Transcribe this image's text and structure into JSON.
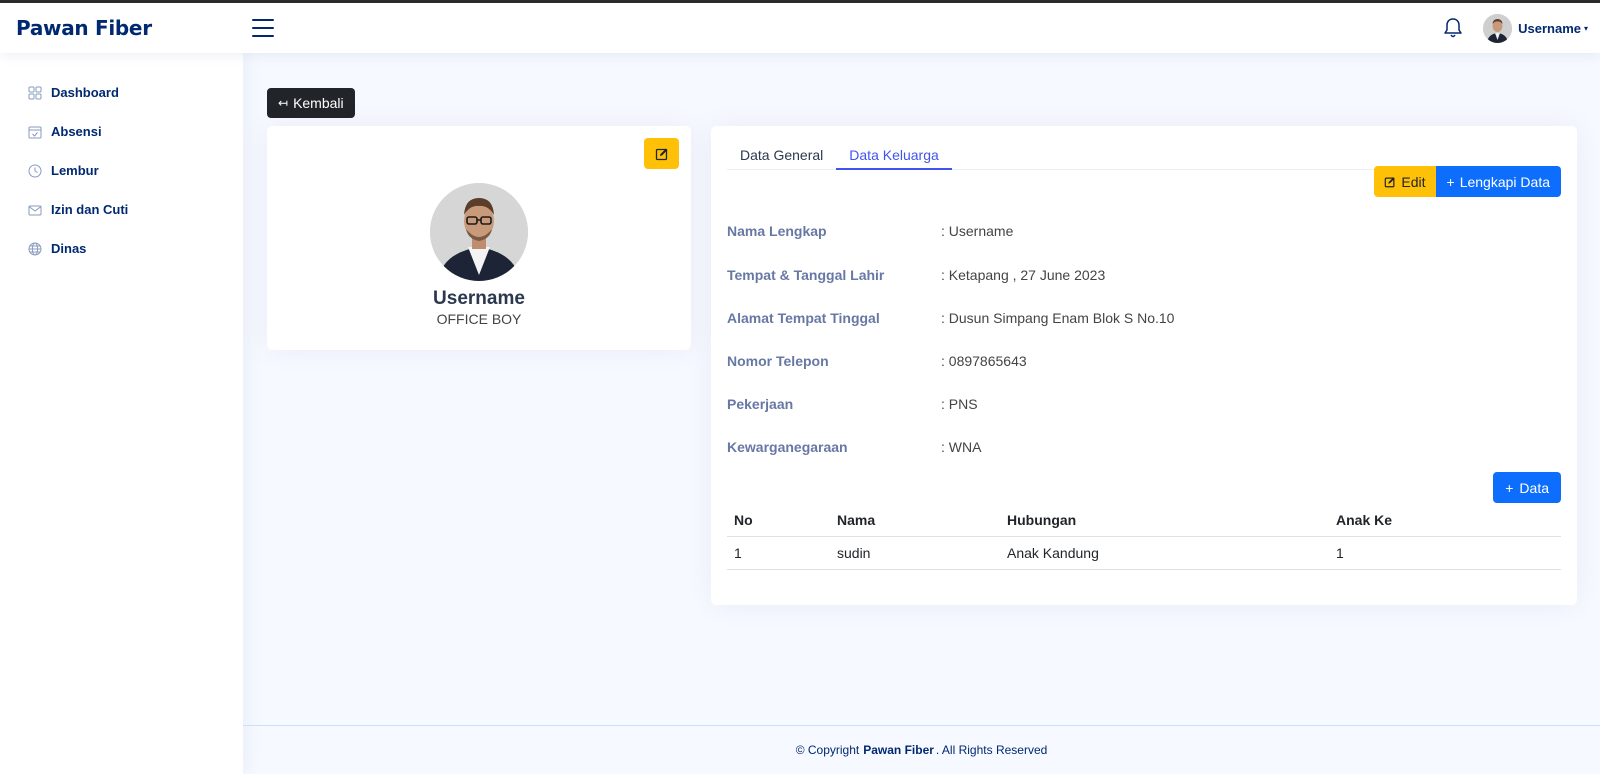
{
  "header": {
    "brand": "Pawan Fiber",
    "user_name": "Username",
    "caret": "▾"
  },
  "sidebar": {
    "items": [
      {
        "label": "Dashboard",
        "icon": "grid-icon"
      },
      {
        "label": "Absensi",
        "icon": "calendar-icon"
      },
      {
        "label": "Lembur",
        "icon": "clock-icon"
      },
      {
        "label": "Izin dan Cuti",
        "icon": "envelope-icon"
      },
      {
        "label": "Dinas",
        "icon": "globe-icon"
      }
    ]
  },
  "main": {
    "back_label": "Kembali",
    "back_icon": "↤",
    "profile": {
      "name": "Username",
      "role": "OFFICE BOY"
    },
    "tabs": [
      {
        "label": "Data General"
      },
      {
        "label": "Data Keluarga"
      }
    ],
    "actions": {
      "edit_label": "Edit",
      "lengkapi_label": "Lengkapi Data",
      "plus": "+",
      "add_data_label": "Data"
    },
    "details": [
      {
        "label": "Nama Lengkap",
        "value": ": Username"
      },
      {
        "label": "Tempat & Tanggal Lahir",
        "value": ": Ketapang , 27 June 2023"
      },
      {
        "label": "Alamat Tempat Tinggal",
        "value": ": Dusun Simpang Enam Blok S No.10"
      },
      {
        "label": "Nomor Telepon",
        "value": ": 0897865643"
      },
      {
        "label": "Pekerjaan",
        "value": ": PNS"
      },
      {
        "label": "Kewarganegaraan",
        "value": ": WNA"
      }
    ],
    "table": {
      "headers": [
        "No",
        "Nama",
        "Hubungan",
        "Anak Ke"
      ],
      "rows": [
        [
          "1",
          "sudin",
          "Anak Kandung",
          "1"
        ]
      ]
    }
  },
  "footer": {
    "prefix": "© Copyright",
    "brand": "Pawan Fiber",
    "suffix": ". All Rights Reserved"
  },
  "colors": {
    "brand": "#012970",
    "accent": "#4154f1",
    "primary": "#0d6efd",
    "warning": "#ffc107",
    "dark": "#212529"
  }
}
